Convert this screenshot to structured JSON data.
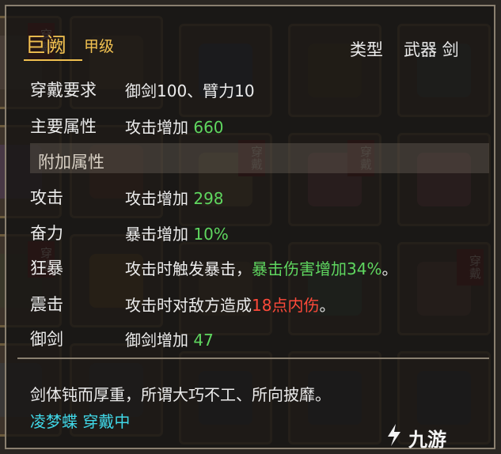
{
  "item": {
    "name": "巨阙",
    "grade": "甲级",
    "type_label": "类型",
    "type_value": "武器 剑"
  },
  "rows": {
    "requirement": {
      "label": "穿戴要求",
      "text": "御剑100、臂力10"
    },
    "main_attr": {
      "label": "主要属性",
      "prefix": "攻击增加 ",
      "value": "660"
    },
    "section_header": "附加属性",
    "attack": {
      "label": "攻击",
      "prefix": "攻击增加 ",
      "value": "298"
    },
    "fervor": {
      "label": "奋力",
      "prefix": "暴击增加 ",
      "value": "10%"
    },
    "berserk": {
      "label": "狂暴",
      "prefix": "攻击时触发暴击，",
      "highlight": "暴击伤害增加34%",
      "suffix": "。"
    },
    "shock": {
      "label": "震击",
      "prefix": "攻击时对敌方造成",
      "highlight": "18点内伤",
      "suffix": "。"
    },
    "sword_control": {
      "label": "御剑",
      "prefix": "御剑增加 ",
      "value": "47"
    }
  },
  "description": "剑体钝而厚重，所谓大巧不工、所向披靡。",
  "owner": "凌梦蝶 穿戴中",
  "background": {
    "worn_tag": "穿戴"
  },
  "watermark": "九游",
  "colors": {
    "gold": "#f0c050",
    "white": "#ececec",
    "green": "#5fd65f",
    "red": "#ff4a3a",
    "cyan": "#40d8e8"
  }
}
